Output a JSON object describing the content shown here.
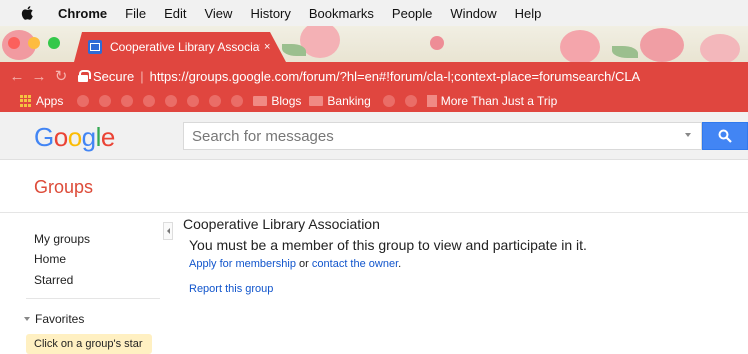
{
  "menubar": {
    "app_name": "Chrome",
    "items": [
      "File",
      "Edit",
      "View",
      "History",
      "Bookmarks",
      "People",
      "Window",
      "Help"
    ]
  },
  "tab": {
    "title": "Cooperative Library Associati",
    "close_label": "×"
  },
  "address_bar": {
    "secure_label": "Secure",
    "separator": "|",
    "url": "https://groups.google.com/forum/?hl=en#!forum/cla-l;context-place=forumsearch/CLA"
  },
  "bookmarks": {
    "apps_label": "Apps",
    "folder_1": "Blogs",
    "folder_2": "Banking",
    "link_1": "More Than Just a Trip"
  },
  "google": {
    "logo_letters": [
      "G",
      "o",
      "o",
      "g",
      "l",
      "e"
    ],
    "logo_colors": [
      "#4285f4",
      "#ea4335",
      "#fbbc05",
      "#4285f4",
      "#34a853",
      "#ea4335"
    ],
    "search_placeholder": "Search for messages"
  },
  "groups": {
    "title": "Groups"
  },
  "left_nav": {
    "my_groups": "My groups",
    "home": "Home",
    "starred": "Starred",
    "favorites": "Favorites",
    "favorites_note": "Click on a group's star"
  },
  "main": {
    "group_name": "Cooperative Library Association",
    "notice": "You must be a member of this group to view and participate in it.",
    "apply_link": "Apply for membership",
    "or_text": " or ",
    "contact_link": "contact the owner",
    "period": ".",
    "report_link": "Report this group"
  },
  "colors": {
    "chrome_theme_red": "#e0463f",
    "groups_red": "#dd4b39",
    "link_blue": "#1155cc",
    "search_button_blue": "#4285f4"
  }
}
